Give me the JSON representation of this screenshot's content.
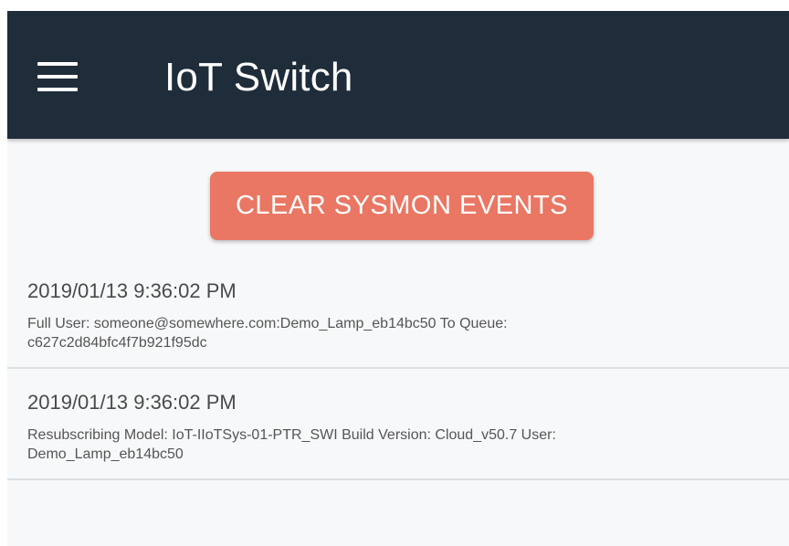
{
  "app_bar": {
    "menu_icon": "hamburger-menu-icon",
    "title": "IoT Switch",
    "background_color": "#1f2c3a"
  },
  "actions": {
    "clear_label": "CLEAR SYSMON EVENTS",
    "clear_color": "#e97763"
  },
  "events": [
    {
      "timestamp": "2019/01/13 9:36:02 PM",
      "message": "Full User: someone@somewhere.com:Demo_Lamp_eb14bc50 To Queue: c627c2d84bfc4f7b921f95dc"
    },
    {
      "timestamp": "2019/01/13 9:36:02 PM",
      "message": "Resubscribing Model: IoT-IIoTSys-01-PTR_SWI Build Version: Cloud_v50.7 User: Demo_Lamp_eb14bc50"
    }
  ]
}
